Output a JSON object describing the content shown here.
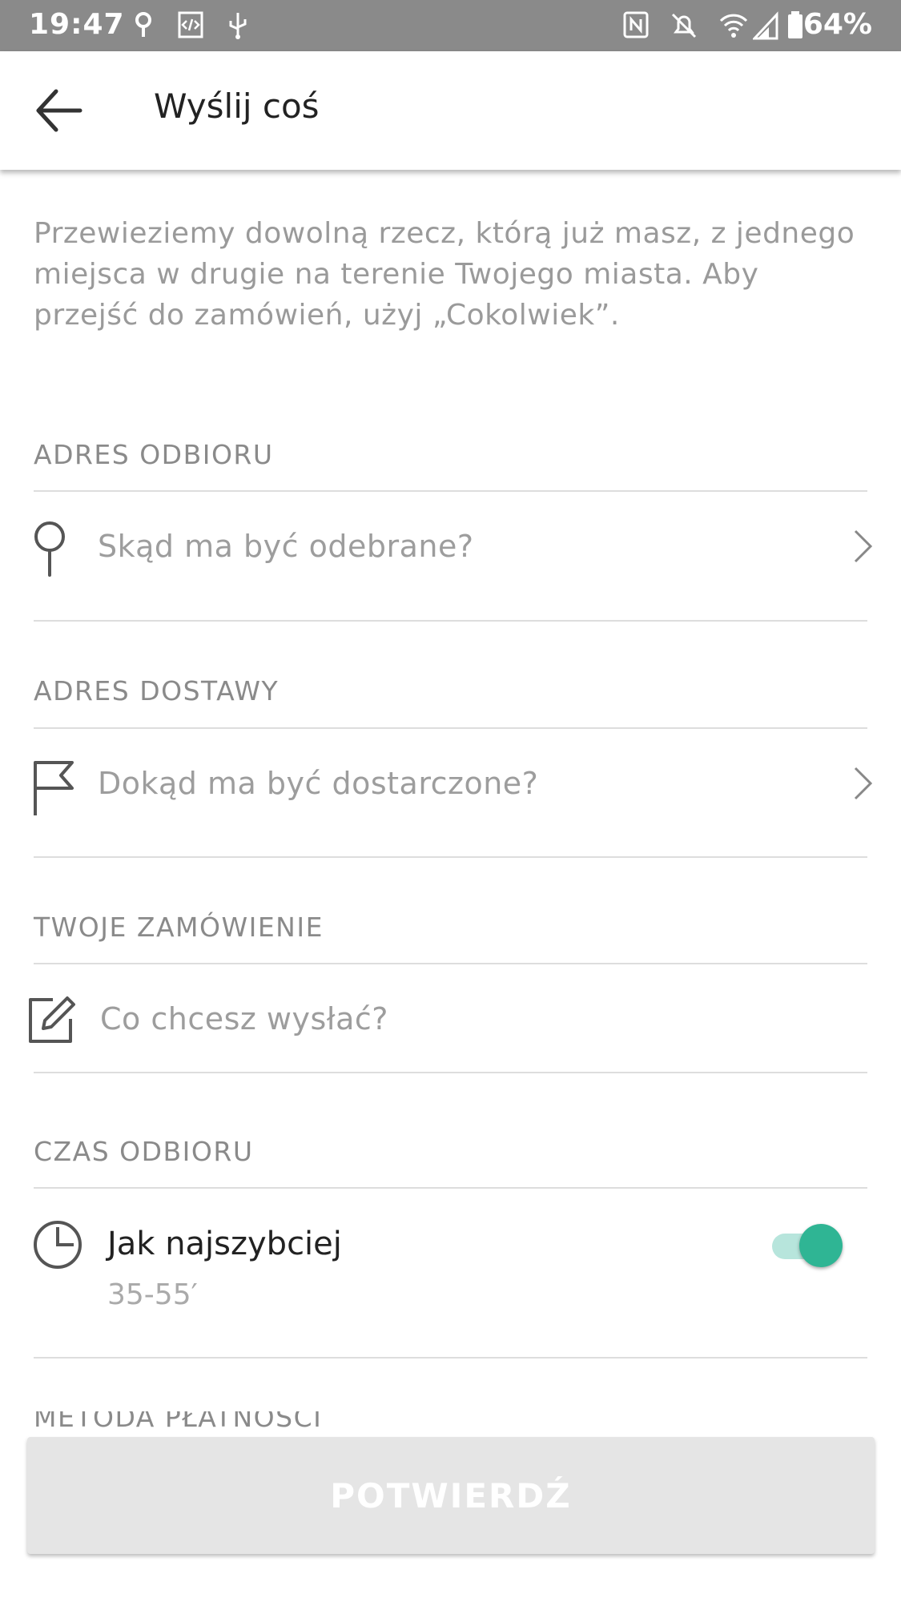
{
  "status_bar": {
    "time": "19:47",
    "battery": "64%",
    "icons": [
      "location-icon",
      "code-icon",
      "usb-icon",
      "nfc-icon",
      "bell-off-icon",
      "wifi-icon",
      "signal-icon",
      "battery-icon"
    ]
  },
  "app_bar": {
    "title": "Wyślij coś",
    "back_icon": "arrow-left-icon"
  },
  "intro_text": "Przewieziemy dowolną rzecz, którą już masz, z jednego miejsca w drugie na terenie Twojego miasta. Aby przejść do zamówień, użyj „Cokolwiek”.",
  "pickup": {
    "label": "ADRES ODBIORU",
    "placeholder": "Skąd ma być odebrane?"
  },
  "delivery": {
    "label": "ADRES DOSTAWY",
    "placeholder": "Dokąd ma być dostarczone?"
  },
  "order": {
    "label": "TWOJE ZAMÓWIENIE",
    "placeholder": "Co chcesz wysłać?"
  },
  "pickup_time": {
    "label": "CZAS ODBIORU",
    "option": "Jak najszybciej",
    "estimate": "35-55′",
    "toggle_on": true
  },
  "payment_label": "METODA PŁATNOŚCI",
  "confirm_button": "POTWIERDŹ",
  "colors": {
    "accent": "#2fb594",
    "status_bar": "#8a8a8a"
  }
}
